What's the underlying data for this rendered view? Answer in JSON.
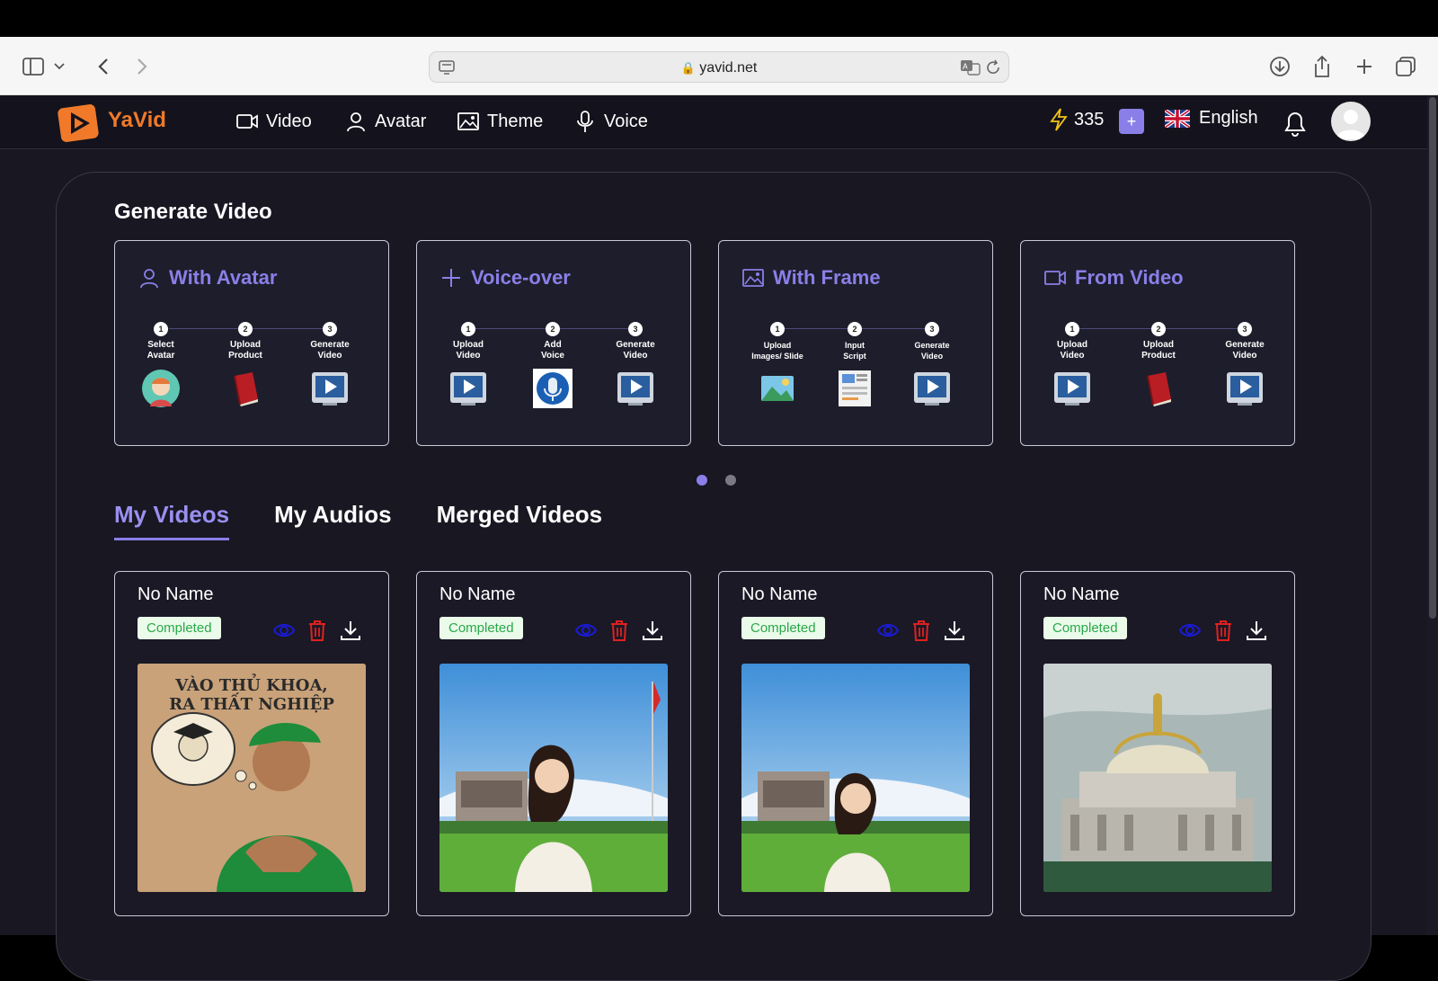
{
  "browser": {
    "url": "yavid.net"
  },
  "nav": {
    "brand": "YaVid",
    "items": [
      {
        "label": "Video",
        "icon": "video-icon"
      },
      {
        "label": "Avatar",
        "icon": "user-icon"
      },
      {
        "label": "Theme",
        "icon": "image-icon"
      },
      {
        "label": "Voice",
        "icon": "microphone-icon"
      }
    ],
    "credits": "335",
    "language": "English"
  },
  "generate": {
    "title": "Generate Video",
    "cards": [
      {
        "title": "With Avatar",
        "icon": "user-icon",
        "steps": [
          {
            "num": "1",
            "label": "Select\nAvatar"
          },
          {
            "num": "2",
            "label": "Upload\nProduct"
          },
          {
            "num": "3",
            "label": "Generate\nVideo"
          }
        ]
      },
      {
        "title": "Voice-over",
        "icon": "plus-icon",
        "steps": [
          {
            "num": "1",
            "label": "Upload\nVideo"
          },
          {
            "num": "2",
            "label": "Add\nVoice"
          },
          {
            "num": "3",
            "label": "Generate\nVideo"
          }
        ]
      },
      {
        "title": "With Frame",
        "icon": "image-icon",
        "steps": [
          {
            "num": "1",
            "label": "Upload\nImages/ Slide"
          },
          {
            "num": "2",
            "label": "Input\nScript"
          },
          {
            "num": "3",
            "label": "Generate\nVideo"
          }
        ]
      },
      {
        "title": "From Video",
        "icon": "video-icon",
        "steps": [
          {
            "num": "1",
            "label": "Upload\nVideo"
          },
          {
            "num": "2",
            "label": "Upload\nProduct"
          },
          {
            "num": "3",
            "label": "Generate\nVideo"
          }
        ]
      }
    ]
  },
  "tabs": [
    "My Videos",
    "My Audios",
    "Merged Videos"
  ],
  "videos": [
    {
      "name": "No Name",
      "status": "Completed",
      "thumb_text": "VÀO THỦ KHOA,\nRA THẤT NGHIỆP"
    },
    {
      "name": "No Name",
      "status": "Completed"
    },
    {
      "name": "No Name",
      "status": "Completed"
    },
    {
      "name": "No Name",
      "status": "Completed"
    }
  ],
  "colors": {
    "accent": "#8a7fe8",
    "brand": "#f07a2a",
    "background": "#181722",
    "status_ok": "#2aa84a"
  }
}
